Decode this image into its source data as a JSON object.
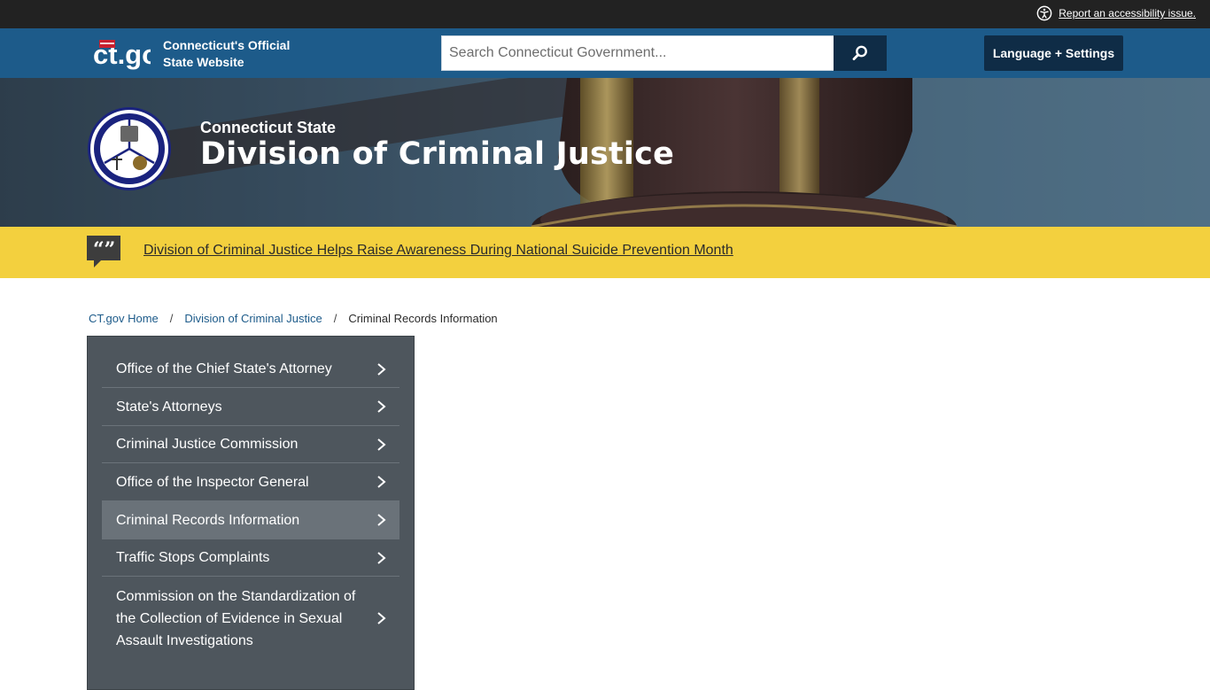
{
  "utility": {
    "accessibility_link": "Report an accessibility issue."
  },
  "header": {
    "logo_text": "ct.gov",
    "site_name_line1": "Connecticut's Official",
    "site_name_line2": "State Website",
    "search_placeholder": "Search Connecticut Government...",
    "language_button": "Language + Settings"
  },
  "hero": {
    "subtitle": "Connecticut State",
    "title": "Division of Criminal Justice"
  },
  "alert": {
    "link_text": "Division of Criminal Justice Helps Raise Awareness During National Suicide Prevention Month"
  },
  "breadcrumb": {
    "items": [
      "CT.gov Home",
      "Division of Criminal Justice"
    ],
    "current": "Criminal Records Information",
    "separator": "/"
  },
  "sidenav": {
    "items": [
      {
        "label": "Office of the Chief State's Attorney"
      },
      {
        "label": "State's Attorneys"
      },
      {
        "label": "Criminal Justice Commission"
      },
      {
        "label": "Office of the Inspector General"
      },
      {
        "label": "Criminal Records Information"
      },
      {
        "label": "Traffic Stops Complaints"
      },
      {
        "label": "Commission on the Standardization of the Collection of Evidence in Sexual Assault Investigations"
      }
    ]
  },
  "colors": {
    "header": "#1d5b8a",
    "utility_bar": "#222222",
    "alert": "#f3d03e",
    "button_dark": "#0f2c46",
    "sidenav": "#4e565d"
  }
}
